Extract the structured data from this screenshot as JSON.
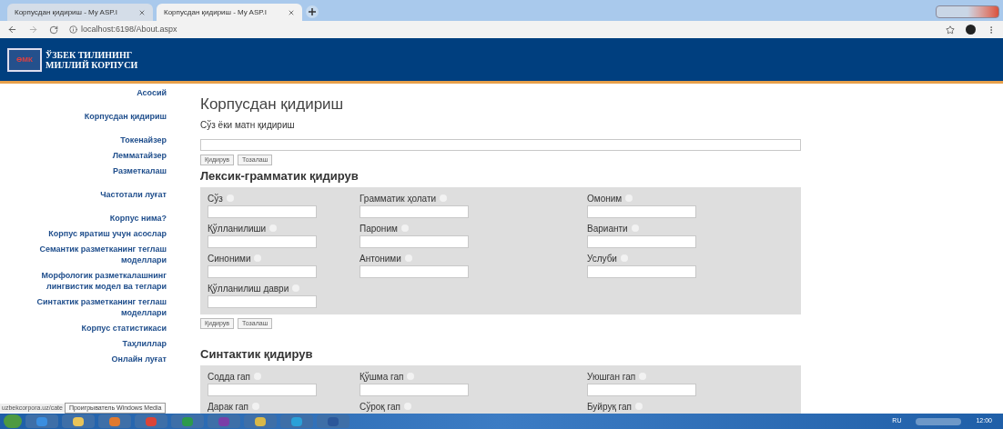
{
  "browser": {
    "tabs": [
      {
        "title": "Корпусдан қидириш - My ASP.I",
        "selected": false
      },
      {
        "title": "Корпусдан қидириш - My ASP.I",
        "selected": true
      }
    ],
    "address": "localhost:6198/About.aspx"
  },
  "header": {
    "logo_mark": "ӨМК",
    "title_lines": [
      "ЎЗБЕК ТИЛИНИНГ",
      "МИЛЛИЙ КОРПУСИ"
    ]
  },
  "sidebar": {
    "groups": [
      [
        "Асосий"
      ],
      [
        "Корпусдан қидириш"
      ],
      [
        "Токенайзер",
        "Лемматайзер",
        "Разметкалаш"
      ],
      [
        "Частотали луғат"
      ],
      [
        "Корпус нима?",
        "Корпус яратиш учун асослар",
        "Семантик разметканинг теглаш моделлари",
        "Морфологик разметкалашнинг лингвистик модел ва теглари",
        "Синтактик разметканинг теглаш моделлари",
        "Корпус статистикаси",
        "Таҳлиллар",
        "Онлайн луғат"
      ]
    ]
  },
  "main": {
    "title": "Корпусдан қидириш",
    "search_label": "Сўз ёки матн қидириш",
    "buttons": [
      "Қидирув",
      "Тозалаш"
    ],
    "sections": [
      {
        "title": "Лексик-грамматик қидирув",
        "rows": [
          [
            "Сўз",
            "Грамматик ҳолати",
            "Омоним"
          ],
          [
            "Қўлланилиши",
            "Пароним",
            "Варианти"
          ],
          [
            "Синоними",
            "Антоними",
            "Услуби"
          ],
          [
            "Қўлланилиш даври"
          ]
        ],
        "buttons": [
          "Қидирув",
          "Тозалаш"
        ]
      },
      {
        "title": "Синтактик қидирув",
        "rows": [
          [
            "Содда гап",
            "Қўшма гап",
            "Уюшган гап"
          ],
          [
            "Дарак гап",
            "Сўроқ гап",
            "Буйруқ гап"
          ]
        ]
      }
    ]
  },
  "status": {
    "url": "uzbekcorpora.uz/cate",
    "tooltip": "Проигрыватель Windows Media"
  },
  "taskbar": {
    "language": "RU",
    "time": "12:00"
  }
}
